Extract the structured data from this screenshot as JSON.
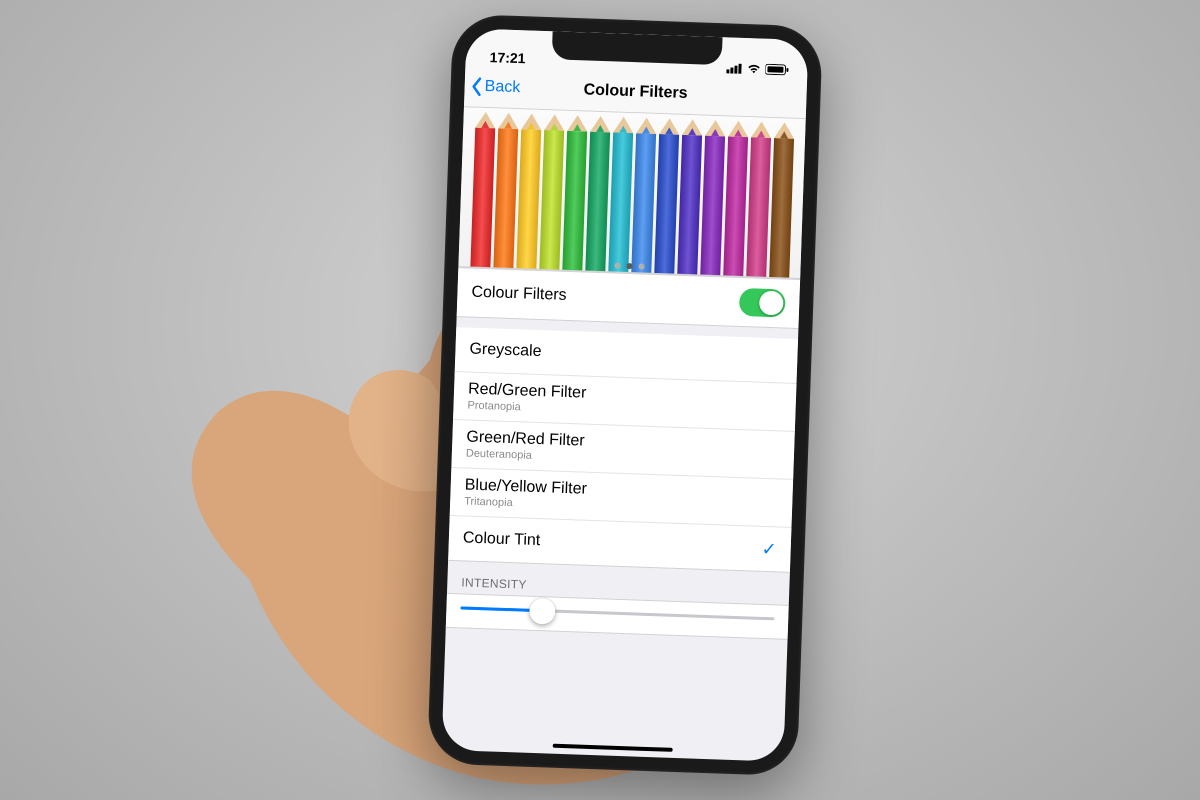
{
  "status": {
    "time": "17:21"
  },
  "nav": {
    "back_label": "Back",
    "title": "Colour Filters"
  },
  "preview": {
    "pencil_colors": [
      "#e23a3a",
      "#f07c2a",
      "#f2c335",
      "#b7d43a",
      "#3fb84a",
      "#29a56b",
      "#34b7c9",
      "#4a8be0",
      "#3a59c7",
      "#5a3fbe",
      "#8a3ab8",
      "#b83aa1",
      "#c94a8a",
      "#8a5a2a"
    ],
    "page_dots_total": 3,
    "page_dots_active_index": 1
  },
  "toggle_row": {
    "label": "Colour Filters",
    "on": true
  },
  "filters": [
    {
      "title": "Greyscale",
      "subtitle": "",
      "selected": false
    },
    {
      "title": "Red/Green Filter",
      "subtitle": "Protanopia",
      "selected": false
    },
    {
      "title": "Green/Red Filter",
      "subtitle": "Deuteranopia",
      "selected": false
    },
    {
      "title": "Blue/Yellow Filter",
      "subtitle": "Tritanopia",
      "selected": false
    },
    {
      "title": "Colour Tint",
      "subtitle": "",
      "selected": true
    }
  ],
  "intensity": {
    "header": "INTENSITY",
    "value_percent": 26
  },
  "colors": {
    "tint": "#007aff",
    "toggle_on": "#34c759"
  }
}
